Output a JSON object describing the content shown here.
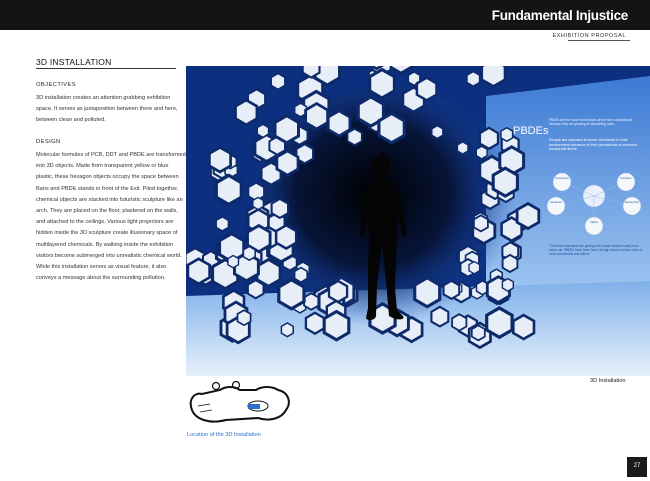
{
  "header": {
    "title": "Fundamental Injustice",
    "subtitle": "EXHIBITION PROPOSAL"
  },
  "section": {
    "heading": "3D INSTALLATION",
    "objectives_label": "OBJECTIVES",
    "objectives_text": "3D installation creates an attention grabbing exhibition space. It serves as juxtaposition between there and here, between clean and polluted.",
    "design_label": "DESIGN",
    "design_text": "Molecular formules of PCB, DDT and PBDE are transformed into 3D objects. Made from transparent yellow or blue plastic, these hexagon objects occupy the space between Bans and PBDE stands in front of the Exit. Piled together, chemical objects are stacked into futuristic sculpture like an arch. They are placed on the floor, plastered on the walls, and attached to the ceilings. Various light projectors are hidden inside the 3D sculpture create illusionary space of multilayered chemicals. By walking inside the exhibition visitors become submerged into unrealistic chemical world. While this installation serves as visual feature, it also conveys a message about the surrounding pollution."
  },
  "figure": {
    "panel_heading": "PBDEs",
    "panel_text_1": "PBDEs are the most recent toxins of the new contaminants, because they are growing at astonishing rates.",
    "panel_text_2": "People are exposed to these chemicals in their environment because of their prevalence in common household items.",
    "panel_text_3": "The flame retardants are getting into human bodies mostly from indoor air. PBDEs have been found at high levels in indoor dust of most households and offices.",
    "diagram_labels": [
      "Computers",
      "Furniture",
      "Airplanes",
      "Electronics",
      "Fabric"
    ],
    "caption": "3D Installation"
  },
  "location": {
    "caption": "Location of the 3D Installation"
  },
  "page": {
    "number": "27"
  },
  "colors": {
    "header_bg": "#141414",
    "accent_blue": "#2a6fc9",
    "hexagon_fill": "#e8eef8",
    "hexagon_stroke": "#0d2a6a"
  }
}
